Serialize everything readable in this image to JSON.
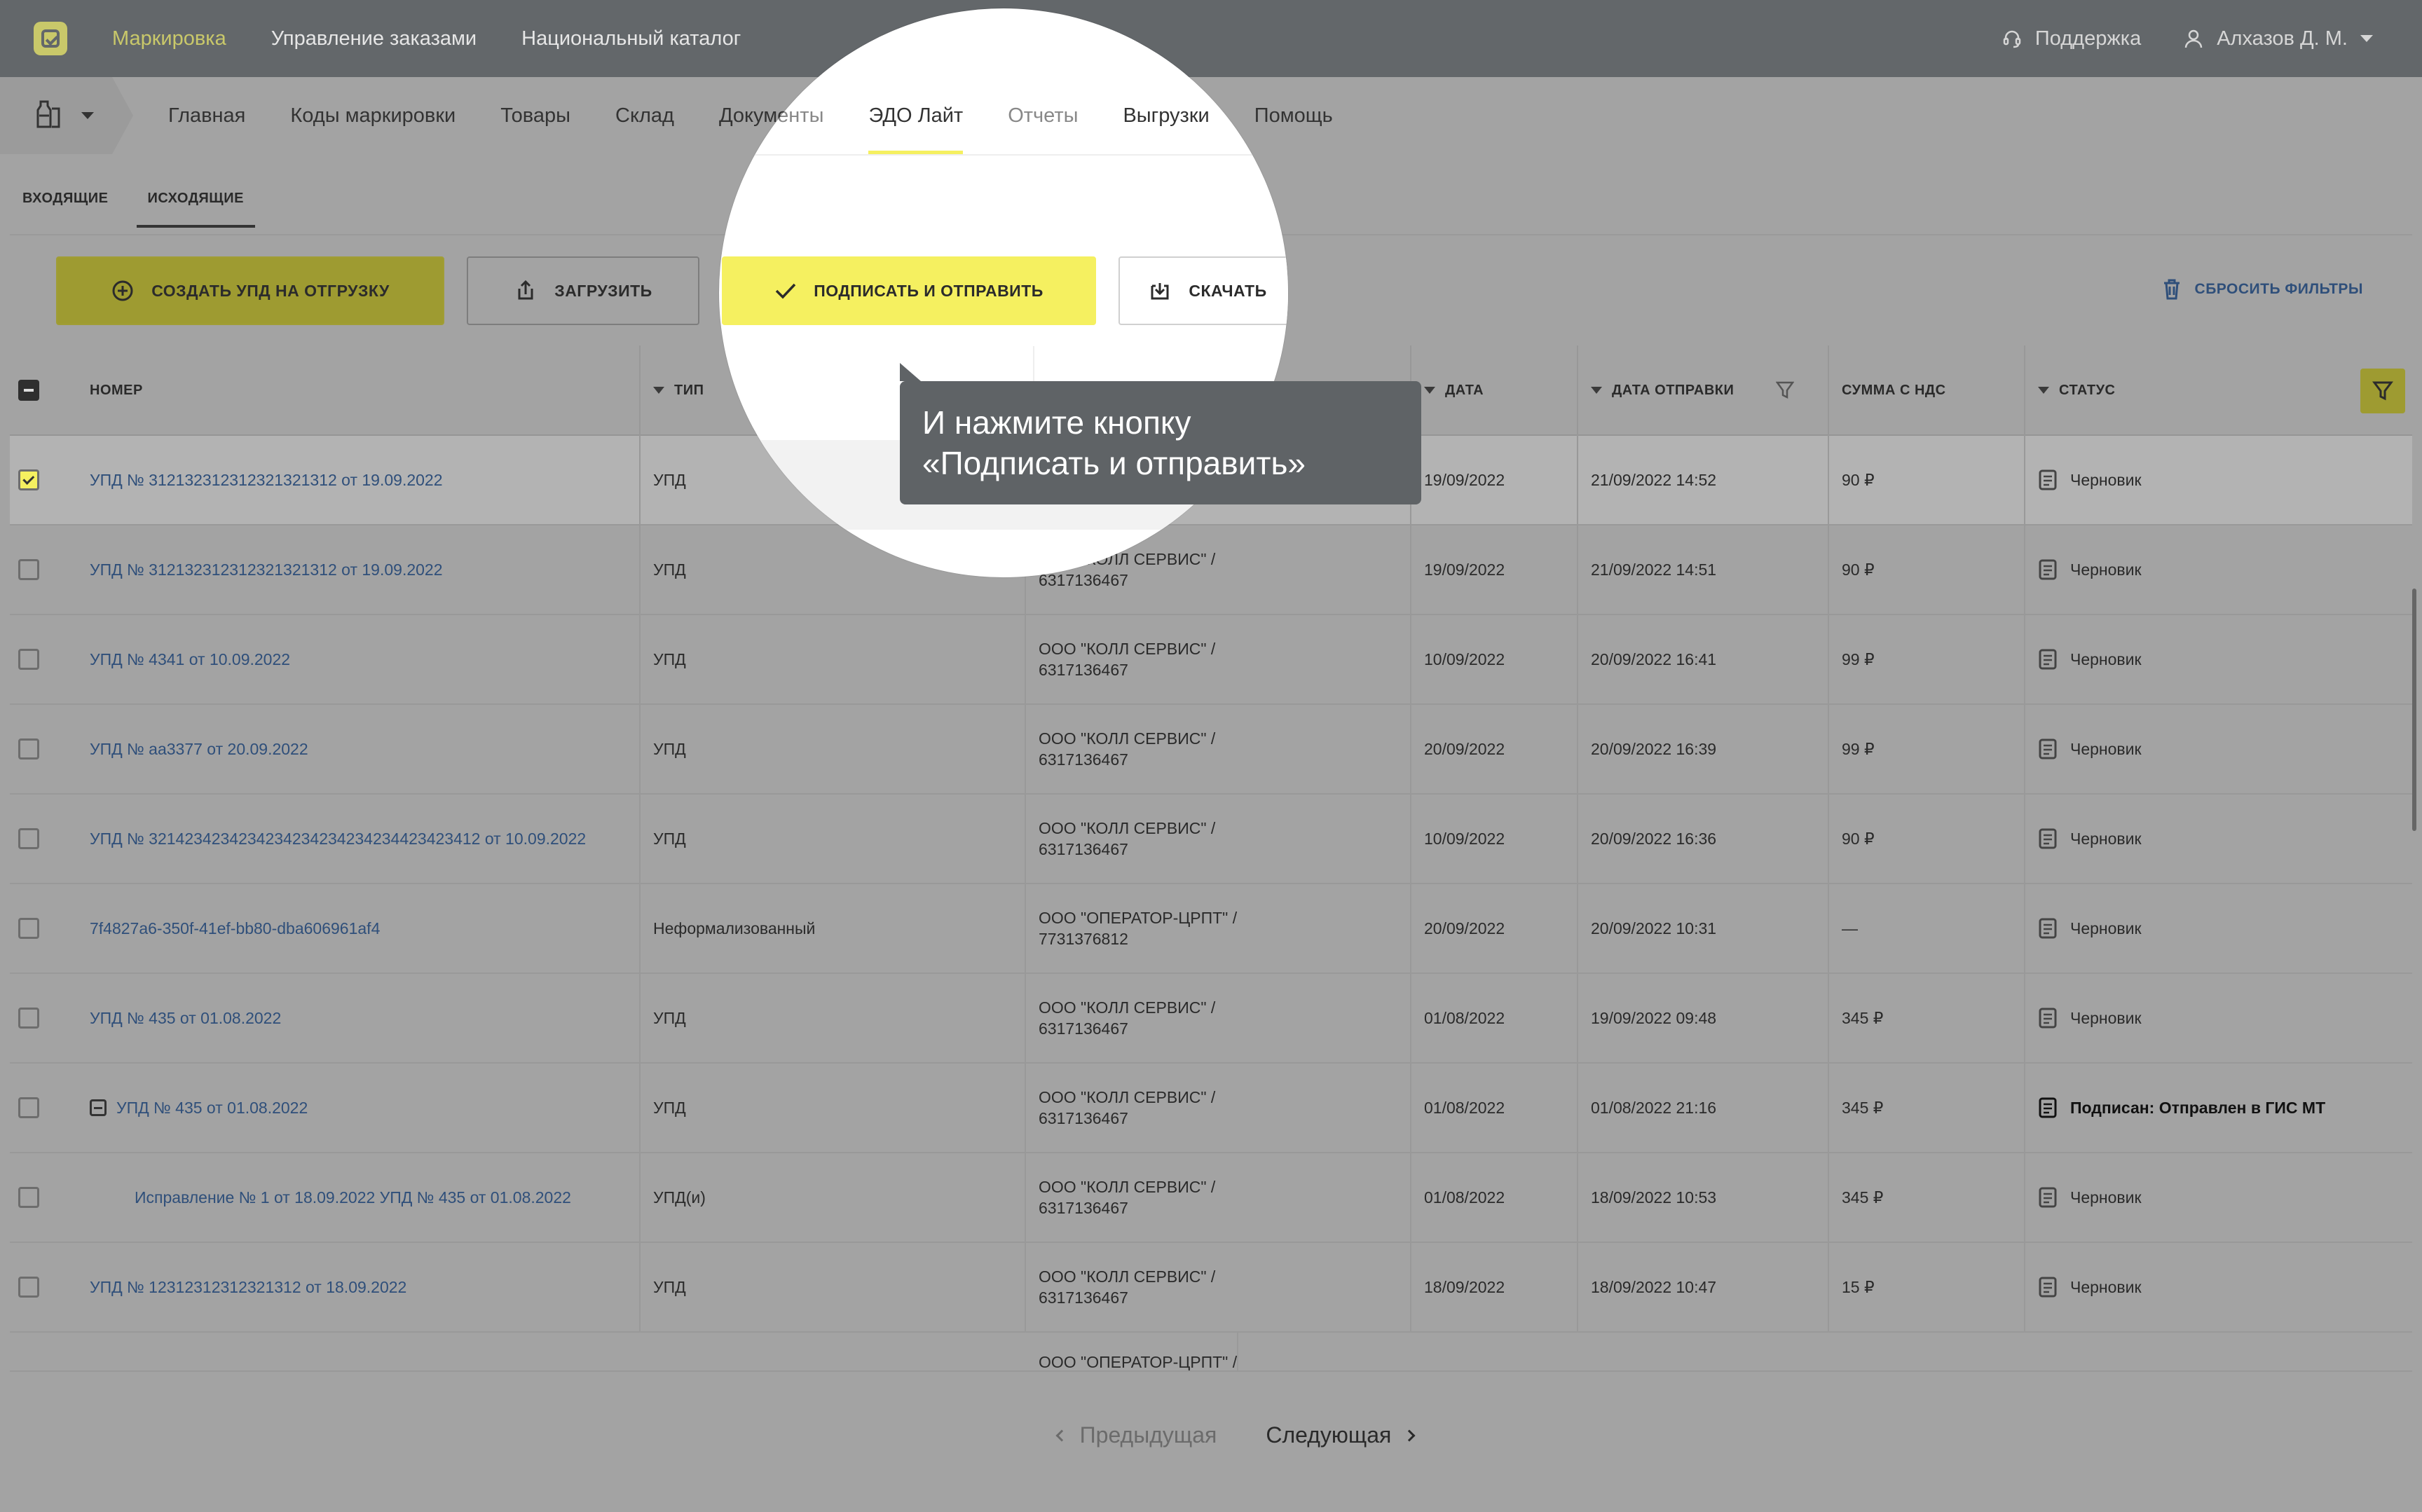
{
  "top_nav": {
    "items": [
      "Маркировка",
      "Управление заказами",
      "Национальный каталог"
    ],
    "support": "Поддержка",
    "user": "Алхазов Д. М."
  },
  "sub_nav": {
    "items": [
      "Главная",
      "Коды маркировки",
      "Товары",
      "Склад",
      "Документы",
      "ЭДО Лайт",
      "Отчеты",
      "Выгрузки",
      "Помощь"
    ],
    "active": "ЭДО Лайт"
  },
  "direction_tabs": [
    "ВХОДЯЩИЕ",
    "ИСХОДЯЩИЕ"
  ],
  "toolbar": {
    "create": "СОЗДАТЬ УПД НА ОТГРУЗКУ",
    "upload": "ЗАГРУЗИТЬ",
    "sign": "ПОДПИСАТЬ И ОТПРАВИТЬ",
    "download": "СКАЧАТЬ",
    "reset_filters": "СБРОСИТЬ ФИЛЬТРЫ"
  },
  "table": {
    "headers": {
      "number": "НОМЕР",
      "type": "ТИП",
      "date": "ДАТА",
      "sent_date": "ДАТА ОТПРАВКИ",
      "sum": "СУММА С НДС",
      "status": "СТАТУС"
    },
    "rows": [
      {
        "number": "УПД № 312132312312321321312 от 19.09.2022",
        "type": "УПД",
        "org1": "",
        "org2": "",
        "date": "19/09/2022",
        "sent": "21/09/2022 14:52",
        "sum": "90 ₽",
        "status": "Черновик"
      },
      {
        "number": "УПД № 312132312312321321312 от 19.09.2022",
        "type": "УПД",
        "org1": "ООО \"КОЛЛ СЕРВИС\" /",
        "org2": "6317136467",
        "date": "19/09/2022",
        "sent": "21/09/2022 14:51",
        "sum": "90 ₽",
        "status": "Черновик"
      },
      {
        "number": "УПД № 4341 от 10.09.2022",
        "type": "УПД",
        "org1": "ООО \"КОЛЛ СЕРВИС\" /",
        "org2": "6317136467",
        "date": "10/09/2022",
        "sent": "20/09/2022 16:41",
        "sum": "99 ₽",
        "status": "Черновик"
      },
      {
        "number": "УПД № аа3377 от 20.09.2022",
        "type": "УПД",
        "org1": "ООО \"КОЛЛ СЕРВИС\" /",
        "org2": "6317136467",
        "date": "20/09/2022",
        "sent": "20/09/2022 16:39",
        "sum": "99 ₽",
        "status": "Черновик"
      },
      {
        "number": "УПД № 3214234234234234234234234234423423412 от 10.09.2022",
        "type": "УПД",
        "org1": "ООО \"КОЛЛ СЕРВИС\" /",
        "org2": "6317136467",
        "date": "10/09/2022",
        "sent": "20/09/2022 16:36",
        "sum": "90 ₽",
        "status": "Черновик"
      },
      {
        "number": "7f4827a6-350f-41ef-bb80-dba606961af4",
        "type": "Неформализованный",
        "org1": "ООО \"ОПЕРАТОР-ЦРПТ\" /",
        "org2": "7731376812",
        "date": "20/09/2022",
        "sent": "20/09/2022 10:31",
        "sum": "—",
        "status": "Черновик"
      },
      {
        "number": "УПД № 435 от 01.08.2022",
        "type": "УПД",
        "org1": "ООО \"КОЛЛ СЕРВИС\" /",
        "org2": "6317136467",
        "date": "01/08/2022",
        "sent": "19/09/2022 09:48",
        "sum": "345 ₽",
        "status": "Черновик"
      },
      {
        "number": "УПД № 435 от 01.08.2022",
        "type": "УПД",
        "org1": "ООО \"КОЛЛ СЕРВИС\" /",
        "org2": "6317136467",
        "date": "01/08/2022",
        "sent": "01/08/2022 21:16",
        "sum": "345 ₽",
        "status": "Подписан: Отправлен в ГИС МТ"
      },
      {
        "number": "Исправление № 1 от 18.09.2022 УПД № 435 от 01.08.2022",
        "type": "УПД(и)",
        "org1": "ООО \"КОЛЛ СЕРВИС\" /",
        "org2": "6317136467",
        "date": "01/08/2022",
        "sent": "18/09/2022 10:53",
        "sum": "345 ₽",
        "status": "Черновик"
      },
      {
        "number": "УПД № 12312312312321312 от 18.09.2022",
        "type": "УПД",
        "org1": "ООО \"КОЛЛ СЕРВИС\" /",
        "org2": "6317136467",
        "date": "18/09/2022",
        "sent": "18/09/2022 10:47",
        "sum": "15 ₽",
        "status": "Черновик"
      }
    ],
    "partial_row_org": "ООО \"ОПЕРАТОР-ЦРПТ\" /"
  },
  "pager": {
    "prev": "Предыдущая",
    "next": "Следующая"
  },
  "tooltip": {
    "line1": "И нажмите кнопку",
    "line2": "«Подписать и отправить»"
  },
  "colors": {
    "accent_yellow": "#f5f060",
    "link_blue": "#2f4f7a",
    "topbar": "#63676a",
    "overlay_gray": "#a3a3a3"
  }
}
